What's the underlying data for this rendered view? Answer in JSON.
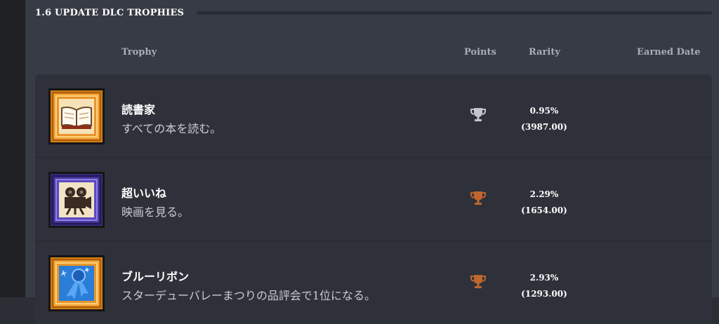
{
  "section": {
    "title": "1.6 UPDATE DLC TROPHIES"
  },
  "columns": {
    "trophy": "Trophy",
    "points": "Points",
    "rarity": "Rarity",
    "earned_date": "Earned Date"
  },
  "trophies": [
    {
      "name": "読書家",
      "description": "すべての本を読む。",
      "grade": "silver",
      "cup_color": "#c2c6cc",
      "rarity_percent": "0.95%",
      "rarity_points": "(3987.00)",
      "icon": "open-book-icon"
    },
    {
      "name": "超いいね",
      "description": "映画を見る。",
      "grade": "bronze",
      "cup_color": "#c0652e",
      "rarity_percent": "2.29%",
      "rarity_points": "(1654.00)",
      "icon": "movie-camera-icon"
    },
    {
      "name": "ブルーリボン",
      "description": "スターデューバレーまつりの品評会で1位になる。",
      "grade": "bronze",
      "cup_color": "#c0652e",
      "rarity_percent": "2.93%",
      "rarity_points": "(1293.00)",
      "icon": "blue-ribbon-icon"
    }
  ]
}
